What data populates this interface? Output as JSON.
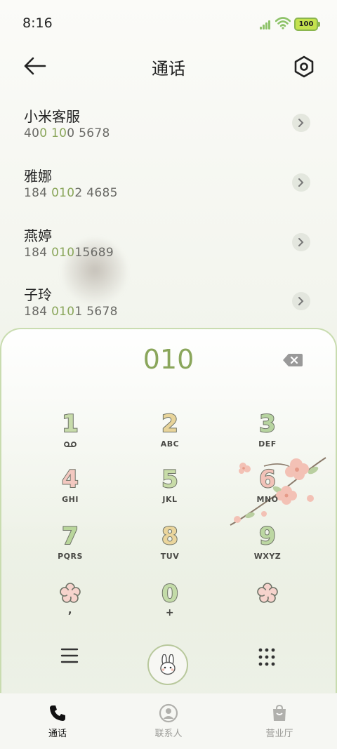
{
  "status_bar": {
    "time": "8:16",
    "battery": "100"
  },
  "header": {
    "title": "通话"
  },
  "results": [
    {
      "name": "小米客服",
      "number_pre": "40",
      "number_match": "0 10",
      "number_post": "0 5678"
    },
    {
      "name": "雅娜",
      "number_pre": "184 ",
      "number_match": "010",
      "number_post": "2 4685"
    },
    {
      "name": "燕婷",
      "number_pre": "184 ",
      "number_match": "010",
      "number_post": "15689"
    },
    {
      "name": "子玲",
      "number_pre": "184 ",
      "number_match": "010",
      "number_post": "1 5678"
    }
  ],
  "dialpad": {
    "number": "010",
    "keys": [
      {
        "digit": "1",
        "letters": ""
      },
      {
        "digit": "2",
        "letters": "ABC"
      },
      {
        "digit": "3",
        "letters": "DEF"
      },
      {
        "digit": "4",
        "letters": "GHI"
      },
      {
        "digit": "5",
        "letters": "JKL"
      },
      {
        "digit": "6",
        "letters": "MNO"
      },
      {
        "digit": "7",
        "letters": "PQRS"
      },
      {
        "digit": "8",
        "letters": "TUV"
      },
      {
        "digit": "9",
        "letters": "WXYZ"
      },
      {
        "digit": "",
        "letters": ","
      },
      {
        "digit": "0",
        "letters": "+"
      },
      {
        "digit": "",
        "letters": ""
      }
    ]
  },
  "bottom_nav": [
    {
      "label": "通话",
      "active": true
    },
    {
      "label": "联系人",
      "active": false
    },
    {
      "label": "营业厅",
      "active": false
    }
  ],
  "colors": {
    "accent": "#8aa65b",
    "text": "#222222",
    "muted": "#9a9a96",
    "border": "#c9dcb0"
  },
  "icons": [
    "back-arrow-icon",
    "settings-hex-icon",
    "chevron-right-icon",
    "backspace-icon",
    "voicemail-icon",
    "flower-icon",
    "menu-icon",
    "bunny-call-icon",
    "keypad-grid-icon",
    "phone-icon",
    "contact-icon",
    "shopping-bag-icon"
  ]
}
